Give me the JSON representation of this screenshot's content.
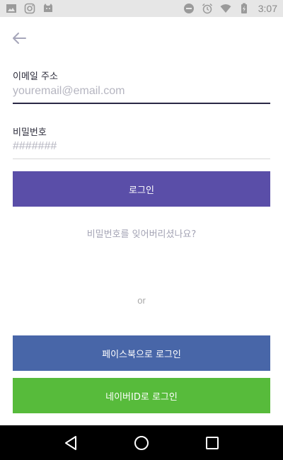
{
  "status_bar": {
    "time": "3:07",
    "left_icons": [
      "image-icon",
      "instagram-icon",
      "cat-app-icon"
    ],
    "right_icons": [
      "do-not-disturb-icon",
      "alarm-icon",
      "wifi-icon",
      "battery-charging-icon"
    ]
  },
  "header": {
    "back_icon": "arrow-back-icon"
  },
  "form": {
    "email_label": "이메일 주소",
    "email_placeholder": "youremail@email.com",
    "email_value": "",
    "password_label": "비밀번호",
    "password_placeholder": "#######",
    "password_value": ""
  },
  "buttons": {
    "login": "로그인",
    "forgot_password": "비밀번호를 잊어버리셨나요?",
    "or": "or",
    "facebook_login": "페이스북으로 로그인",
    "naver_login": "네이버ID로 로그인"
  },
  "colors": {
    "primary": "#5a4ea8",
    "facebook": "#4866a8",
    "naver": "#57bb3b",
    "active_underline": "#2a2845"
  },
  "nav_bar": {
    "icons": [
      "back-triangle-icon",
      "home-circle-icon",
      "recents-square-icon"
    ]
  }
}
